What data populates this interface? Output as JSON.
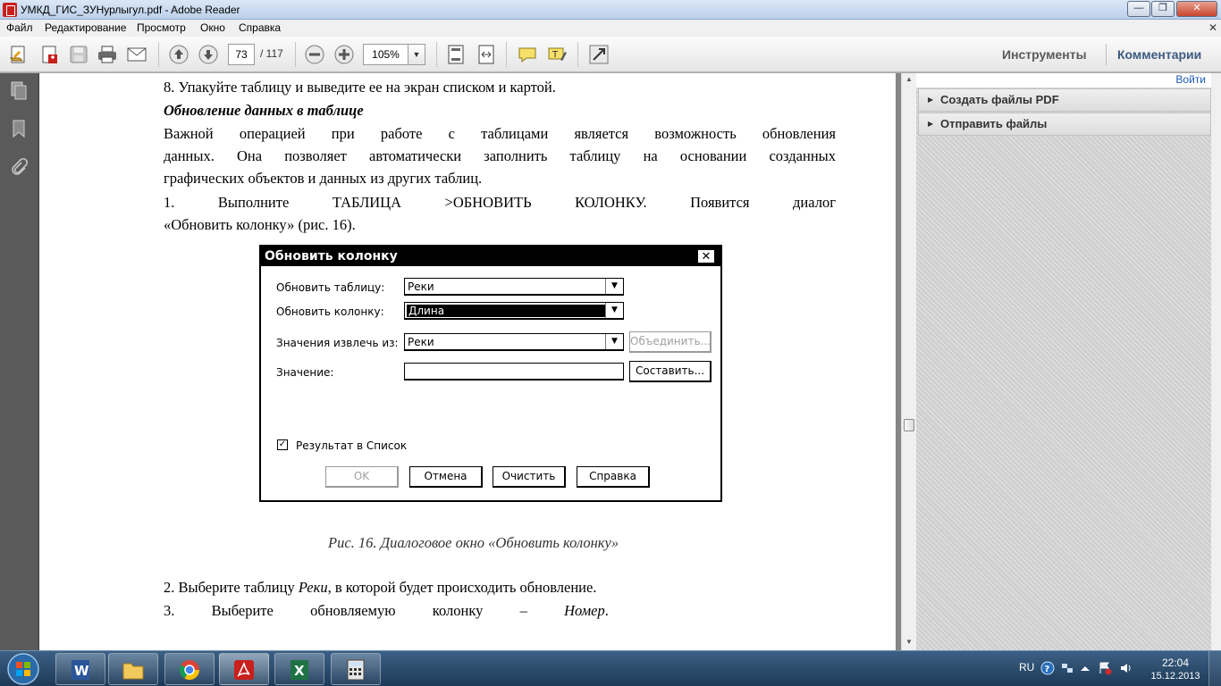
{
  "window": {
    "title": "УМКД_ГИС_ЗУНурлыгул.pdf - Adobe Reader"
  },
  "menu": [
    "Файл",
    "Редактирование",
    "Просмотр",
    "Окно",
    "Справка"
  ],
  "toolbar": {
    "page_current": "73",
    "page_total": "/ 117",
    "zoom": "105%",
    "tools_label": "Инструменты",
    "comments_label": "Комментарии"
  },
  "document": {
    "line1": "8. Упакуйте таблицу и выведите ее на экран списком и картой.",
    "heading": "Обновление данных в таблице",
    "para1_line1": "Важной операцией при работе с        таблицами является возможность обновления",
    "para1_line2": "данных. Она позволяет автоматически заполнить таблицу на основании созданных",
    "para1_line3": "графических объектов и данных из других таблиц.",
    "step1_line1": "1. Выполните   ТАБЛИЦА >ОБНОВИТЬ   КОЛОНКУ.  Появится        диалог",
    "step1_line2": "«Обновить колонку» (рис. 16).",
    "caption": "Рис. 16. Диалоговое окно «Обновить колонку»",
    "step2_pre": "2. Выберите таблицу ",
    "step2_em": "Реки",
    "step2_post": ", в которой будет происходить обновление.",
    "step3_line": "3.          Выберите          обновляемую          колонку          –          ",
    "step3_em": "Номер",
    "step3_end": "."
  },
  "figure_dialog": {
    "title": "Обновить колонку",
    "close": "✕",
    "label_table": "Обновить таблицу:",
    "value_table": "Реки",
    "label_column": "Обновить колонку:",
    "value_column": "Длина",
    "label_from": "Значения извлечь из:",
    "value_from": "Реки",
    "join_button": "Объединить...",
    "label_value": "Значение:",
    "compose_button": "Составить...",
    "checkbox_label": "Результат в Список",
    "ok_button": "OK",
    "cancel_button": "Отмена",
    "clear_button": "Очистить",
    "help_button": "Справка"
  },
  "right_pane": {
    "login": "Войти",
    "panel1": "Создать файлы PDF",
    "panel2": "Отправить файлы"
  },
  "taskbar": {
    "lang": "RU",
    "time": "22:04",
    "date": "15.12.2013"
  }
}
